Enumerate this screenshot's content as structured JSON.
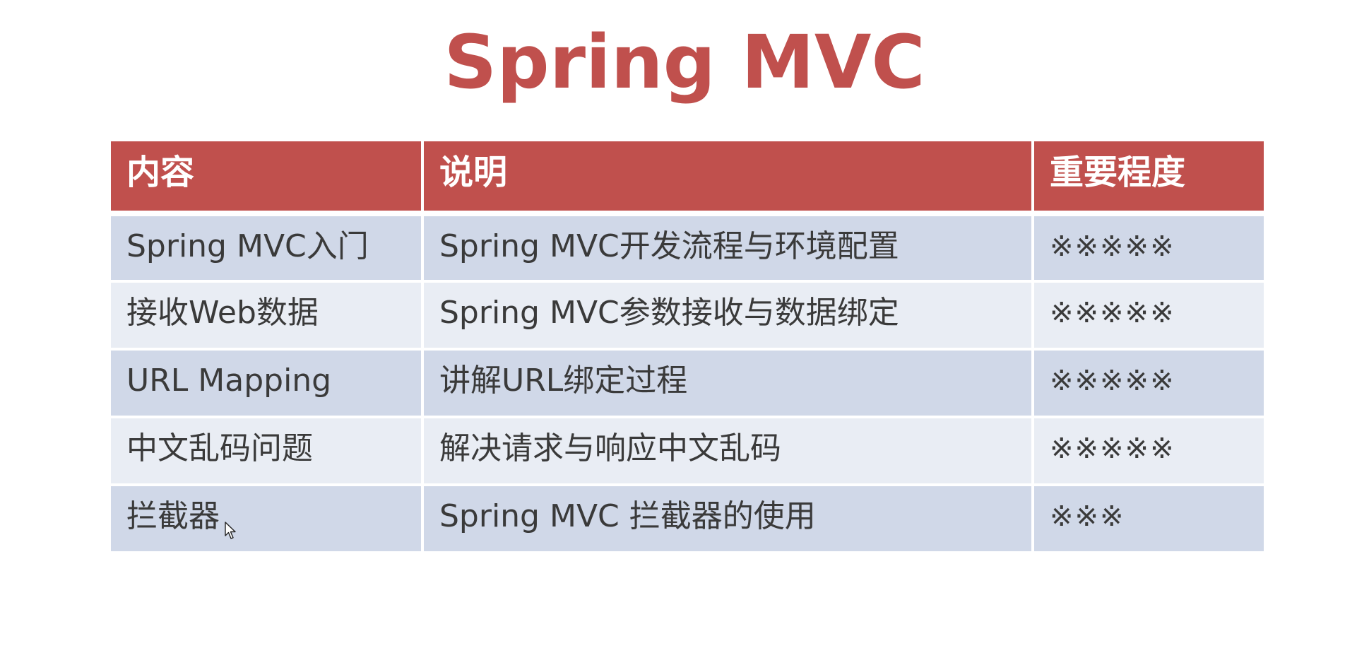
{
  "title": "Spring MVC",
  "table": {
    "headers": [
      "内容",
      "说明",
      "重要程度"
    ],
    "rows": [
      [
        "Spring MVC入门",
        "Spring MVC开发流程与环境配置",
        "※※※※※"
      ],
      [
        "接收Web数据",
        "Spring MVC参数接收与数据绑定",
        "※※※※※"
      ],
      [
        "URL Mapping",
        "讲解URL绑定过程",
        "※※※※※"
      ],
      [
        "中文乱码问题",
        "解决请求与响应中文乱码",
        "※※※※※"
      ],
      [
        "拦截器",
        "Spring MVC 拦截器的使用",
        "※※※"
      ]
    ]
  },
  "colors": {
    "accent": "#c0504d",
    "row_odd": "#d0d8e8",
    "row_even": "#e9edf4",
    "text": "#3a3a3a"
  },
  "icons": {
    "cursor": "mouse-pointer-icon"
  }
}
